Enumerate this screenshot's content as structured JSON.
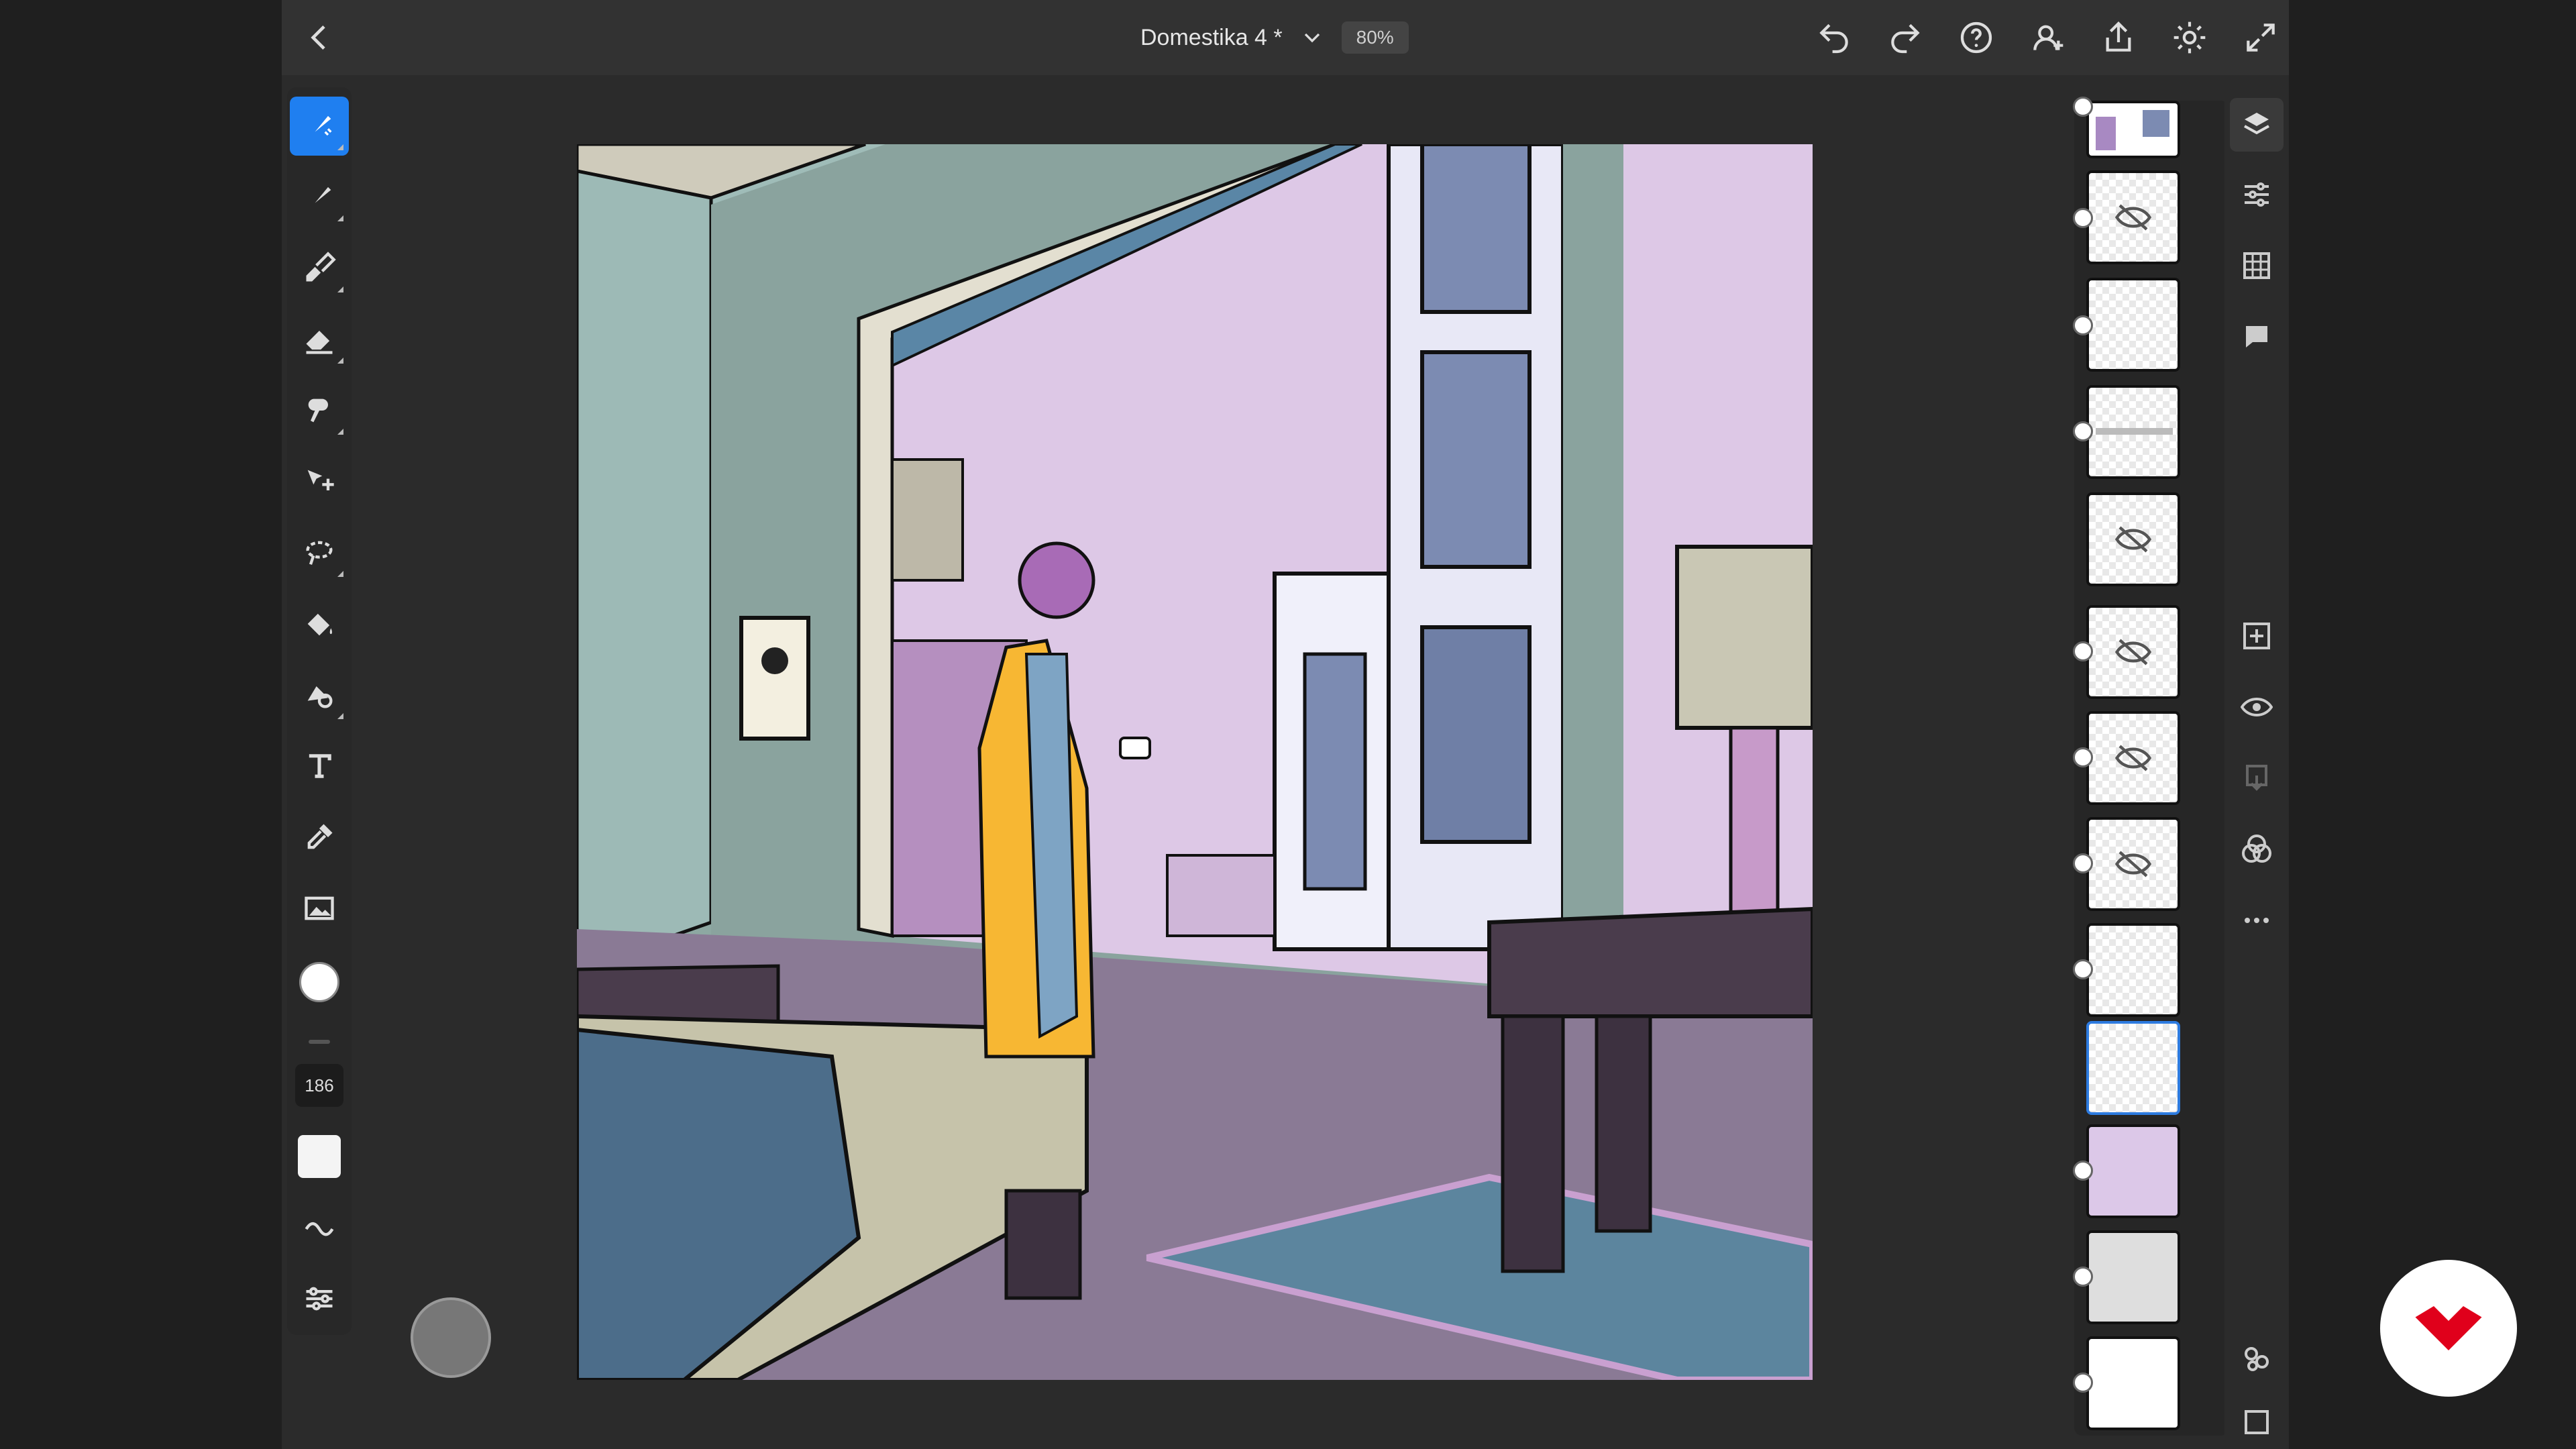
{
  "document": {
    "title": "Domestika 4 *",
    "zoom": "80%"
  },
  "topbar": {
    "icons": [
      "back-icon",
      "chevron-down-icon",
      "undo-icon",
      "redo-icon",
      "help-icon",
      "invite-icon",
      "share-icon",
      "settings-icon",
      "fullscreen-icon"
    ]
  },
  "toolbar": {
    "tools": [
      "live-brush",
      "pixel-brush",
      "vector-brush",
      "eraser",
      "smudge",
      "transform",
      "selection",
      "fill",
      "liquify",
      "type",
      "eyedropper",
      "image",
      "color"
    ],
    "brush_size": "186",
    "active_tool": "live-brush"
  },
  "layers": {
    "count": 13,
    "selected_index": 9
  },
  "rightbar": {
    "icons": [
      "layers-icon",
      "layer-properties-icon",
      "grid-icon",
      "comments-icon",
      "add-layer-icon",
      "visibility-icon",
      "merge-down-icon",
      "blend-icon",
      "more-icon",
      "group-icon",
      "mask-icon"
    ]
  },
  "colors": {
    "accent": "#1f7ff0",
    "selected_layer": "#2d7be0",
    "logo": "#e0001b"
  }
}
